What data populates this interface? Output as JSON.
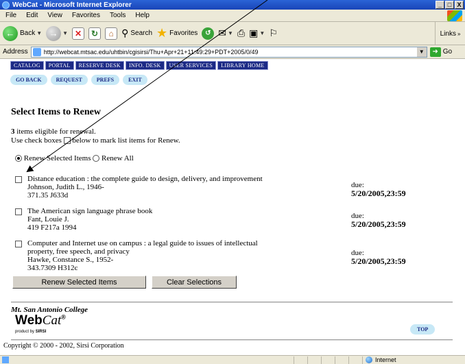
{
  "window": {
    "title": "WebCat - Microsoft Internet Explorer",
    "buttons": [
      "_",
      "□",
      "X"
    ]
  },
  "menu": [
    "File",
    "Edit",
    "View",
    "Favorites",
    "Tools",
    "Help"
  ],
  "toolbar": {
    "back": "Back",
    "search": "Search",
    "favorites": "Favorites",
    "links": "Links"
  },
  "address": {
    "label": "Address",
    "url": "http://webcat.mtsac.edu/uhtbin/cgisirsi/Thu+Apr+21+11:49:29+PDT+2005/0/49",
    "go": "Go"
  },
  "nav": [
    "CATALOG",
    "PORTAL",
    "RESERVE DESK",
    "INFO. DESK",
    "USER SERVICES",
    "LIBRARY HOME"
  ],
  "subnav": [
    "GO BACK",
    "REQUEST",
    "PREFS",
    "EXIT"
  ],
  "page": {
    "heading": "Select Items to Renew",
    "eligible_count": "3",
    "eligible_text": "items eligible for renewal.",
    "checkbox_hint_pre": "Use check boxes",
    "checkbox_hint_post": "below to mark list items for Renew.",
    "renew_selected_label": "Renew Selected Items",
    "renew_all_label": "Renew All",
    "due_label": "due:"
  },
  "items": [
    {
      "title": "Distance education : the complete guide to design, delivery, and improvement",
      "title2": "",
      "author": "Johnson, Judith L., 1946-",
      "call": "371.35 J633d",
      "due": "5/20/2005,23:59"
    },
    {
      "title": "The American sign language phrase book",
      "title2": "",
      "author": "Fant, Louie J.",
      "call": "419 F217a 1994",
      "due": "5/20/2005,23:59"
    },
    {
      "title": "Computer and Internet use on campus : a legal guide to issues of intellectual",
      "title2": "property, free speech, and privacy",
      "author": "Hawke, Constance S., 1952-",
      "call": "343.7309 H312c",
      "due": "5/20/2005,23:59"
    }
  ],
  "buttons": {
    "renew": "Renew Selected Items",
    "clear": "Clear Selections"
  },
  "footer": {
    "college": "Mt. San Antonio College",
    "webcat_bold": "Web",
    "webcat_italic": "Cat",
    "webcat_reg": "®",
    "product_by": "product by",
    "sirsi": "SIRSI",
    "top": "TOP",
    "copyright": "Copyright © 2000 - 2002, Sirsi Corporation"
  },
  "status": {
    "zone": "Internet"
  }
}
